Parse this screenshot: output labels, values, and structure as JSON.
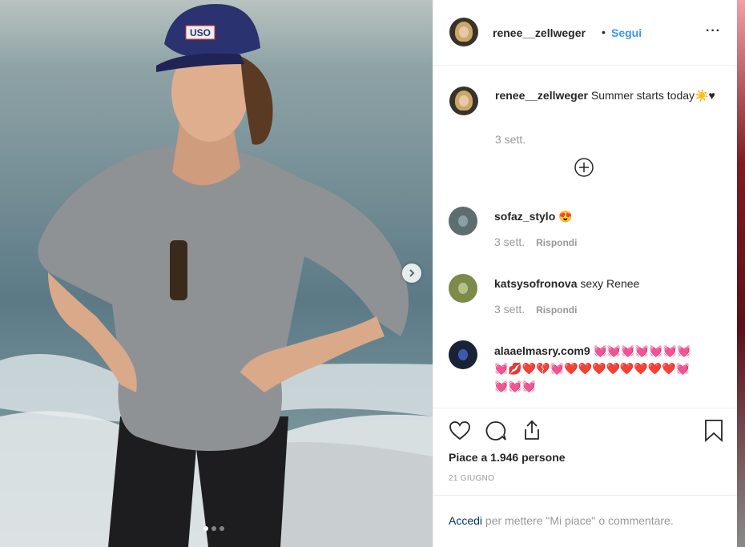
{
  "post": {
    "author": "renee__zellweger",
    "separator": "•",
    "follow_label": "Segui",
    "more_label": "···",
    "caption_user": "renee__zellweger",
    "caption_text": " Summer starts today☀️♥",
    "caption_time": "3 sett.",
    "cap_text": "USO"
  },
  "comments": [
    {
      "user": "sofaz_stylo",
      "text": " 😍",
      "time": "3 sett.",
      "reply": "Rispondi"
    },
    {
      "user": "katsysofronova",
      "text": " sexy Renee",
      "time": "3 sett.",
      "reply": "Rispondi"
    },
    {
      "user": "alaaelmasry.com9",
      "text": " 💓💓💓💓💓💓💓💓💋❤️💔💓❤️❤️❤️❤️❤️❤️❤️❤️💓💓💓💓"
    }
  ],
  "likes_label": "Piace a 1.946 persone",
  "date_label": "21 GIUGNO",
  "login": {
    "link": "Accedi",
    "rest": " per mettere \"Mi piace\" o commentare."
  },
  "colors": {
    "accent": "#3897f0",
    "link_dark": "#003569",
    "muted": "#999999",
    "text": "#262626"
  },
  "icons": [
    "heart-icon",
    "comment-icon",
    "share-icon",
    "bookmark-icon",
    "plus-circle-icon",
    "chevron-right-icon"
  ]
}
